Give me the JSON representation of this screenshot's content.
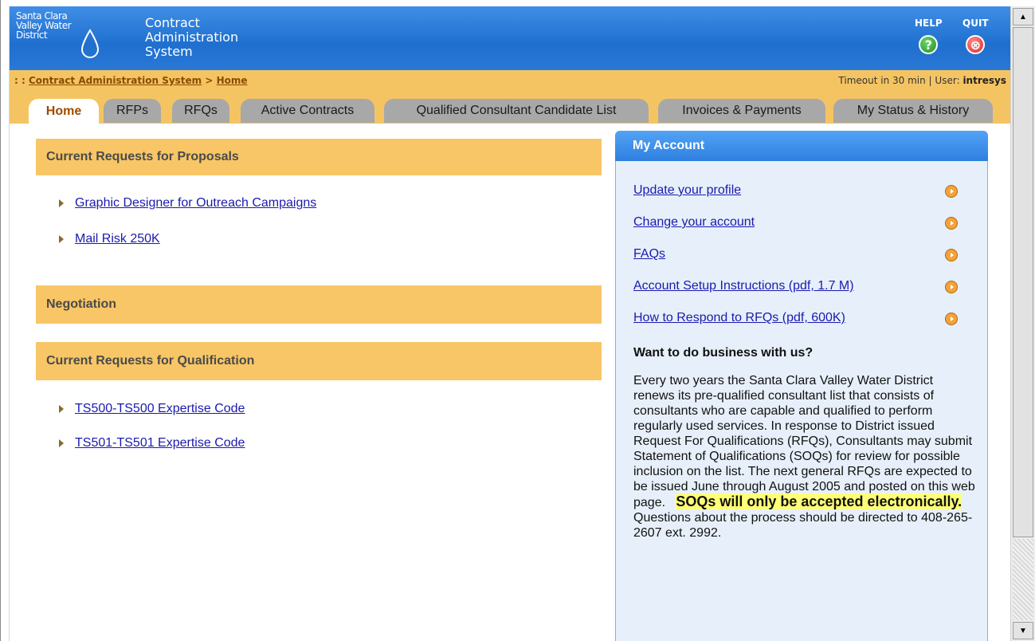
{
  "header": {
    "org_logo_text": "Santa Clara Valley Water District",
    "title_lines": [
      "Contract",
      "Administration",
      "System"
    ],
    "help_label": "HELP",
    "quit_label": "QUIT"
  },
  "breadcrumb": {
    "prefix": ": :",
    "root": "Contract Administration System",
    "separator": ">",
    "current": "Home"
  },
  "status": {
    "timeout": "Timeout in 30 min",
    "separator": "|",
    "user_label": "User:",
    "user_name": "intresys"
  },
  "tabs": [
    {
      "label": "Home",
      "active": true
    },
    {
      "label": "RFPs"
    },
    {
      "label": "RFQs"
    },
    {
      "label": "Active Contracts"
    },
    {
      "label": "Qualified Consultant Candidate List"
    },
    {
      "label": "Invoices & Payments"
    },
    {
      "label": "My Status & History"
    }
  ],
  "sections": {
    "rfp": {
      "title": "Current Requests for Proposals",
      "items": [
        "Graphic Designer for Outreach Campaigns",
        "Mail Risk 250K"
      ]
    },
    "negotiation": {
      "title": "Negotiation"
    },
    "rfq": {
      "title": "Current Requests for Qualification",
      "items": [
        "TS500-TS500 Expertise Code",
        "TS501-TS501 Expertise Code"
      ]
    }
  },
  "account": {
    "title": "My Account",
    "links": [
      "Update your profile",
      "Change your account",
      "FAQs",
      "Account Setup Instructions (pdf, 1.7 M)",
      "How to Respond to RFQs (pdf, 600K)"
    ],
    "business_title": "Want to do business with us?",
    "business_text": "Every two years the Santa Clara Valley Water District renews its pre-qualified consultant list that consists of consultants who are capable and qualified to perform regularly used services. In response to District issued Request For Qualifications (RFQs), Consultants may submit Statement of Qualifications (SOQs) for review for possible inclusion on the list. The next general RFQs are expected to be issued June through August 2005 and posted on this web page.",
    "business_highlight": "SOQs will only be accepted electronically.",
    "business_tail": "Questions about the process should be directed to 408-265-2607 ext. 2992."
  },
  "icons": {
    "help": "help-icon",
    "quit": "quit-icon",
    "logo": "water-drop-icon",
    "link_arrow": "triangle-right-icon",
    "account_arrow": "circle-arrow-icon"
  },
  "colors": {
    "header_blue": "#1f6fcf",
    "tab_bar": "#f5c462",
    "section_head": "#f8c666",
    "account_panel": "#e7f0fa",
    "link": "#1a1ab0"
  }
}
